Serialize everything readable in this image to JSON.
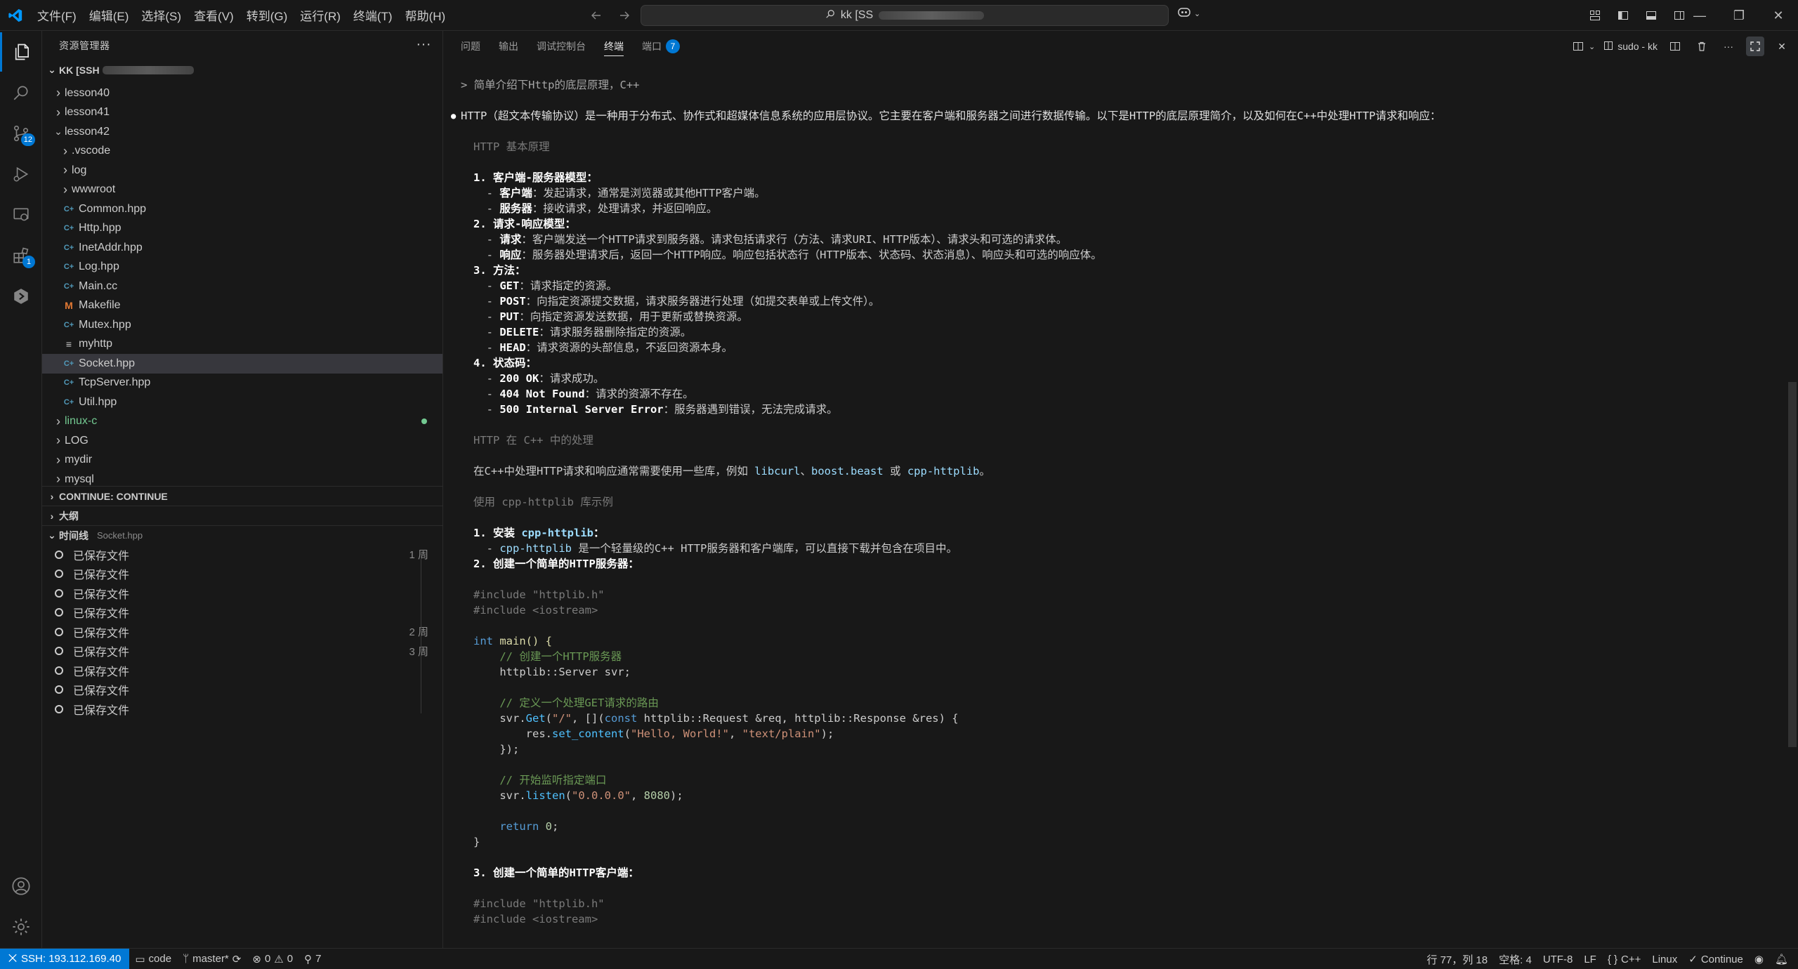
{
  "colors": {
    "accent": "#0078d4",
    "selected_row": "#37373d",
    "git_added": "#73c991",
    "react_icon": "#519aba",
    "makefile_icon": "#e37933"
  },
  "titlebar": {
    "menus": [
      "文件(F)",
      "编辑(E)",
      "选择(S)",
      "查看(V)",
      "转到(G)",
      "运行(R)",
      "终端(T)",
      "帮助(H)"
    ],
    "command_center": "kk [SS"
  },
  "activity": {
    "source_control_badge": "12",
    "extensions_badge": "1"
  },
  "sidebar": {
    "title": "资源管理器",
    "root_label": "KK [SSH",
    "sections": {
      "continue": "CONTINUE: CONTINUE",
      "outline": "大纲",
      "timeline": "时间线",
      "timeline_file": "Socket.hpp"
    },
    "tree": [
      {
        "label": "lesson40",
        "kind": "folder",
        "depth": 1,
        "expanded": false
      },
      {
        "label": "lesson41",
        "kind": "folder",
        "depth": 1,
        "expanded": false
      },
      {
        "label": "lesson42",
        "kind": "folder",
        "depth": 1,
        "expanded": true
      },
      {
        "label": ".vscode",
        "kind": "folder",
        "depth": 2,
        "expanded": false
      },
      {
        "label": "log",
        "kind": "folder",
        "depth": 2,
        "expanded": false
      },
      {
        "label": "wwwroot",
        "kind": "folder",
        "depth": 2,
        "expanded": false
      },
      {
        "label": "Common.hpp",
        "kind": "cpp",
        "depth": 2
      },
      {
        "label": "Http.hpp",
        "kind": "cpp",
        "depth": 2
      },
      {
        "label": "InetAddr.hpp",
        "kind": "cpp",
        "depth": 2
      },
      {
        "label": "Log.hpp",
        "kind": "cpp",
        "depth": 2
      },
      {
        "label": "Main.cc",
        "kind": "cpp",
        "depth": 2
      },
      {
        "label": "Makefile",
        "kind": "make",
        "depth": 2
      },
      {
        "label": "Mutex.hpp",
        "kind": "cpp",
        "depth": 2
      },
      {
        "label": "myhttp",
        "kind": "text",
        "depth": 2
      },
      {
        "label": "Socket.hpp",
        "kind": "cpp",
        "depth": 2,
        "selected": true
      },
      {
        "label": "TcpServer.hpp",
        "kind": "cpp",
        "depth": 2
      },
      {
        "label": "Util.hpp",
        "kind": "cpp",
        "depth": 2
      },
      {
        "label": "linux-c",
        "kind": "folder",
        "depth": 1,
        "expanded": false,
        "modified": true
      },
      {
        "label": "LOG",
        "kind": "folder",
        "depth": 1,
        "expanded": false
      },
      {
        "label": "mydir",
        "kind": "folder",
        "depth": 1,
        "expanded": false
      },
      {
        "label": "mysql",
        "kind": "folder",
        "depth": 1,
        "expanded": false
      }
    ],
    "timeline": [
      {
        "label": "已保存文件",
        "time": "1 周"
      },
      {
        "label": "已保存文件",
        "time": ""
      },
      {
        "label": "已保存文件",
        "time": ""
      },
      {
        "label": "已保存文件",
        "time": ""
      },
      {
        "label": "已保存文件",
        "time": "2 周"
      },
      {
        "label": "已保存文件",
        "time": "3 周"
      },
      {
        "label": "已保存文件",
        "time": ""
      },
      {
        "label": "已保存文件",
        "time": ""
      },
      {
        "label": "已保存文件",
        "time": ""
      }
    ]
  },
  "panel": {
    "tabs": [
      "问题",
      "输出",
      "调试控制台",
      "终端",
      "端口"
    ],
    "active_tab": "终端",
    "ports_badge": "7",
    "terminal_name": "sudo - kk"
  },
  "terminal": {
    "prompt": "> 简单介绍下Http的底层原理，C++",
    "intro": "HTTP（超文本传输协议）是一种用于分布式、协作式和超媒体信息系统的应用层协议。它主要在客户端和服务器之间进行数据传输。以下是HTTP的底层原理简介，以及如何在C++中处理HTTP请求和响应：",
    "h1": "HTTP 基本原理",
    "s1": "1. 客户端-服务器模型：",
    "s1a_k": "客户端",
    "s1a_v": "：发起请求，通常是浏览器或其他HTTP客户端。",
    "s1b_k": "服务器",
    "s1b_v": "：接收请求，处理请求，并返回响应。",
    "s2": "2. 请求-响应模型：",
    "s2a_k": "请求",
    "s2a_v": "：客户端发送一个HTTP请求到服务器。请求包括请求行（方法、请求URI、HTTP版本）、请求头和可选的请求体。",
    "s2b_k": "响应",
    "s2b_v": "：服务器处理请求后，返回一个HTTP响应。响应包括状态行（HTTP版本、状态码、状态消息）、响应头和可选的响应体。",
    "s3": "3. 方法：",
    "m_get_k": "GET",
    "m_get_v": "：请求指定的资源。",
    "m_post_k": "POST",
    "m_post_v": "：向指定资源提交数据，请求服务器进行处理（如提交表单或上传文件）。",
    "m_put_k": "PUT",
    "m_put_v": "：向指定资源发送数据，用于更新或替换资源。",
    "m_del_k": "DELETE",
    "m_del_v": "：请求服务器删除指定的资源。",
    "m_head_k": "HEAD",
    "m_head_v": "：请求资源的头部信息，不返回资源本身。",
    "s4": "4. 状态码：",
    "c200_k": "200 OK",
    "c200_v": "：请求成功。",
    "c404_k": "404 Not Found",
    "c404_v": "：请求的资源不存在。",
    "c500_k": "500 Internal Server Error",
    "c500_v": "：服务器遇到错误，无法完成请求。",
    "h2": "HTTP 在 C++ 中的处理",
    "p2_a": "在C++中处理HTTP请求和响应通常需要使用一些库，例如 ",
    "p2_l1": "libcurl",
    "p2_sep1": "、",
    "p2_l2": "boost.beast",
    "p2_sep2": " 或 ",
    "p2_l3": "cpp-httplib",
    "p2_end": "。",
    "h3": "使用 cpp-httplib 库示例",
    "i1_a": "1. 安装 ",
    "i1_l": "cpp-httplib",
    "i1_b": "：",
    "i1s_l": "cpp-httplib",
    "i1s_v": " 是一个轻量级的C++ HTTP服务器和客户端库，可以直接下载并包含在项目中。",
    "i2": "2. 创建一个简单的HTTP服务器：",
    "inc1": "#include \"httplib.h\"",
    "inc2": "#include <iostream>",
    "c_int": "int",
    "c_main": "main",
    "c_main_rest": "() {",
    "c_cmt1": "    // 创建一个HTTP服务器",
    "c_svr": "    httplib::Server svr;",
    "c_cmt2": "    // 定义一个处理GET请求的路由",
    "c_get_a": "    svr.",
    "c_get_m": "Get",
    "c_get_b": "(",
    "c_get_s": "\"/\"",
    "c_get_c": ", [](",
    "c_get_const": "const",
    "c_get_d": " httplib::Request &req, httplib::Response &res) {",
    "c_set_a": "        res.",
    "c_set_m": "set_content",
    "c_set_b": "(",
    "c_set_s1": "\"Hello, World!\"",
    "c_set_c": ", ",
    "c_set_s2": "\"text/plain\"",
    "c_set_d": ");",
    "c_close1": "    });",
    "c_cmt3": "    // 开始监听指定端口",
    "c_lis_a": "    svr.",
    "c_lis_m": "listen",
    "c_lis_b": "(",
    "c_lis_s": "\"0.0.0.0\"",
    "c_lis_c": ", ",
    "c_lis_n": "8080",
    "c_lis_d": ");",
    "c_ret_a": "    ",
    "c_ret_k": "return",
    "c_ret_sp": " ",
    "c_ret_n": "0",
    "c_ret_d": ";",
    "c_close2": "}",
    "i3": "3. 创建一个简单的HTTP客户端：",
    "inc3": "#include \"httplib.h\"",
    "inc4": "#include <iostream>"
  },
  "statusbar": {
    "remote": "SSH: 193.112.169.40",
    "folder": "code",
    "branch": "master*",
    "errors": "0",
    "warnings": "0",
    "ports": "7",
    "position": "行 77，列 18",
    "spaces": "空格: 4",
    "encoding": "UTF-8",
    "eol": "LF",
    "language": "C++",
    "os": "Linux",
    "continue": "Continue"
  }
}
